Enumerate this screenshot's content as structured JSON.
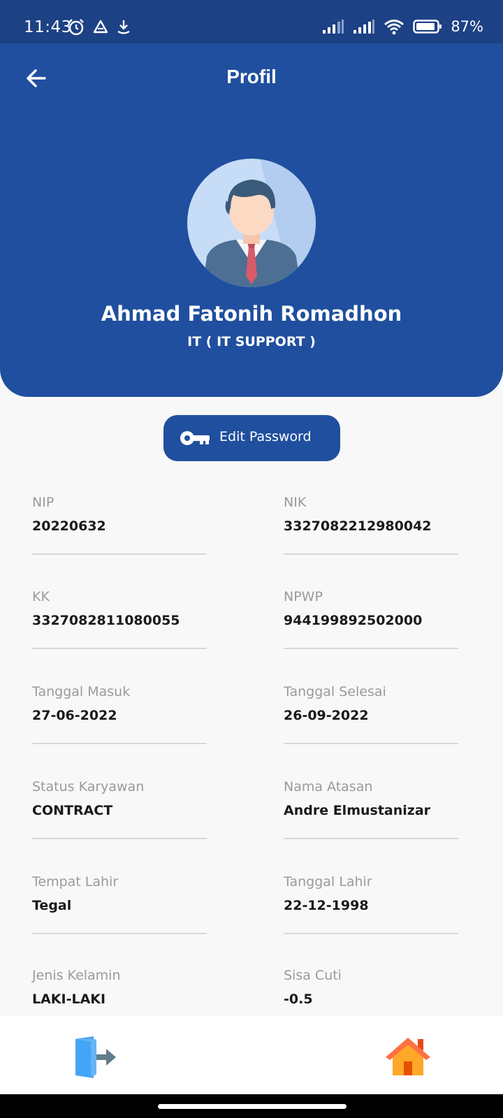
{
  "status_bar": {
    "time": "11:43",
    "battery": "87%"
  },
  "header": {
    "title": "Profil",
    "back_icon": "arrow-left-icon"
  },
  "profile": {
    "name": "Ahmad Fatonih Romadhon",
    "department": "IT ( IT SUPPORT )",
    "avatar_icon": "businessman-avatar-icon"
  },
  "edit_password": {
    "label": "Edit Password",
    "icon": "key-icon"
  },
  "fields": [
    {
      "label": "NIP",
      "value": "20220632"
    },
    {
      "label": "NIK",
      "value": "3327082212980042"
    },
    {
      "label": "KK",
      "value": "3327082811080055"
    },
    {
      "label": "NPWP",
      "value": "944199892502000"
    },
    {
      "label": "Tanggal Masuk",
      "value": "27-06-2022"
    },
    {
      "label": "Tanggal Selesai",
      "value": "26-09-2022"
    },
    {
      "label": "Status Karyawan",
      "value": "CONTRACT"
    },
    {
      "label": "Nama Atasan",
      "value": "Andre Elmustanizar"
    },
    {
      "label": "Tempat Lahir",
      "value": "Tegal"
    },
    {
      "label": "Tanggal Lahir",
      "value": "22-12-1998"
    },
    {
      "label": "Jenis Kelamin",
      "value": "LAKI-LAKI"
    },
    {
      "label": "Sisa Cuti",
      "value": "-0.5"
    }
  ],
  "bottom_nav": {
    "logout_icon": "logout-door-icon",
    "home_icon": "home-icon"
  },
  "colors": {
    "primary": "#1f4f9e",
    "status_bar": "#1d4185",
    "home_orange": "#ff7a2e",
    "logout_blue": "#4da3f5"
  }
}
